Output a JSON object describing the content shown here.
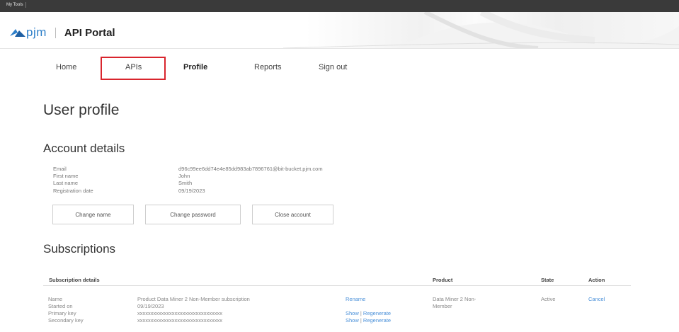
{
  "topbar": {
    "tab_label": "My Tools"
  },
  "header": {
    "logo_text": "pjm",
    "title": "API Portal"
  },
  "nav": {
    "items": [
      {
        "label": "Home"
      },
      {
        "label": "APIs"
      },
      {
        "label": "Profile"
      },
      {
        "label": "Reports"
      },
      {
        "label": "Sign out"
      }
    ],
    "active": "Profile"
  },
  "page": {
    "title": "User profile"
  },
  "account": {
    "title": "Account details",
    "fields": [
      {
        "label": "Email",
        "value": "d96c99ee6dd74e4e85dd983ab7896761@bit-bucket.pjm.com"
      },
      {
        "label": "First name",
        "value": "John"
      },
      {
        "label": "Last name",
        "value": "Smith"
      },
      {
        "label": "Registration date",
        "value": "09/19/2023"
      }
    ],
    "buttons": {
      "change_name": "Change name",
      "change_password": "Change password",
      "close_account": "Close account"
    }
  },
  "subscriptions": {
    "title": "Subscriptions",
    "columns": {
      "details": "Subscription details",
      "product": "Product",
      "state": "State",
      "action": "Action"
    },
    "rows": [
      {
        "labels": [
          "Name",
          "Started on",
          "Primary key",
          "Secondary key"
        ],
        "name": "Product Data Miner 2 Non-Member subscription",
        "rename": "Rename",
        "started_on": "09/19/2023",
        "primary_key": "xxxxxxxxxxxxxxxxxxxxxxxxxxxxxxxx",
        "secondary_key": "xxxxxxxxxxxxxxxxxxxxxxxxxxxxxxxx",
        "show": "Show",
        "separator": "|",
        "regenerate": "Regenerate",
        "product_line1": "Data Miner 2 Non-",
        "product_line2": "Member",
        "state": "Active",
        "action": "Cancel"
      }
    ]
  },
  "colors": {
    "accent": "#2f80c9",
    "highlight_border": "#d9252d",
    "link": "#4a90d9",
    "topbar": "#3a3a3a"
  }
}
